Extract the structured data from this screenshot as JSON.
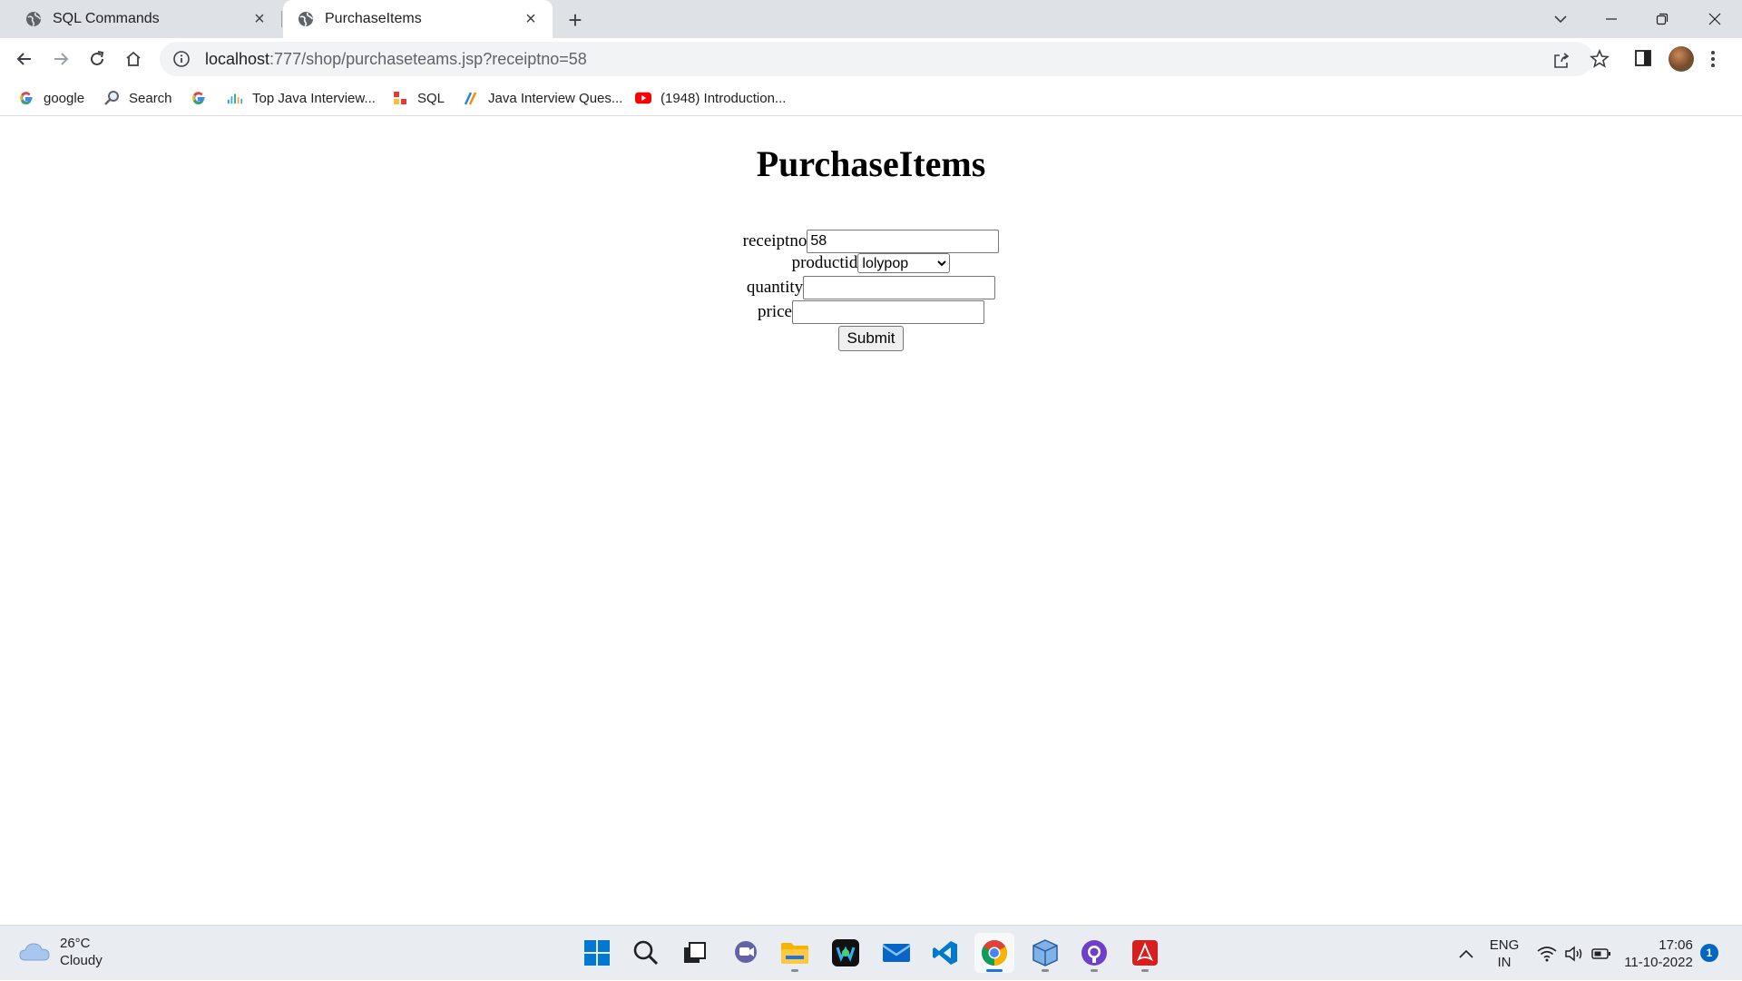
{
  "tabs": [
    {
      "title": "SQL Commands",
      "active": false
    },
    {
      "title": "PurchaseItems",
      "active": true
    }
  ],
  "address_bar": {
    "host": "localhost",
    "path": ":777/shop/purchaseteams.jsp?receiptno=58"
  },
  "bookmarks": [
    {
      "label": "google",
      "icon": "google-icon"
    },
    {
      "label": "Search",
      "icon": "search-icon"
    },
    {
      "label": "",
      "icon": "google-icon"
    },
    {
      "label": "Top Java Interview...",
      "icon": "chart-icon"
    },
    {
      "label": "SQL",
      "icon": "sql-icon"
    },
    {
      "label": "Java Interview Ques...",
      "icon": "pen-icon"
    },
    {
      "label": "(1948) Introduction...",
      "icon": "youtube-icon"
    }
  ],
  "page": {
    "heading": "PurchaseItems",
    "form": {
      "receiptno_label": "receiptno",
      "receiptno_value": "58",
      "productid_label": "productid",
      "productid_selected": "lolypop",
      "quantity_label": "quantity",
      "quantity_value": "",
      "price_label": "price",
      "price_value": "",
      "submit_label": "Submit"
    }
  },
  "taskbar": {
    "weather_temp": "26°C",
    "weather_desc": "Cloudy",
    "language_line1": "ENG",
    "language_line2": "IN",
    "time": "17:06",
    "date": "11-10-2022",
    "notification_count": "1"
  },
  "colors": {
    "tabstrip_bg": "#dee1e6",
    "omnibox_bg": "#f1f3f4",
    "taskbar_bg": "#e9ecf1",
    "accent_blue": "#1a73e8"
  }
}
